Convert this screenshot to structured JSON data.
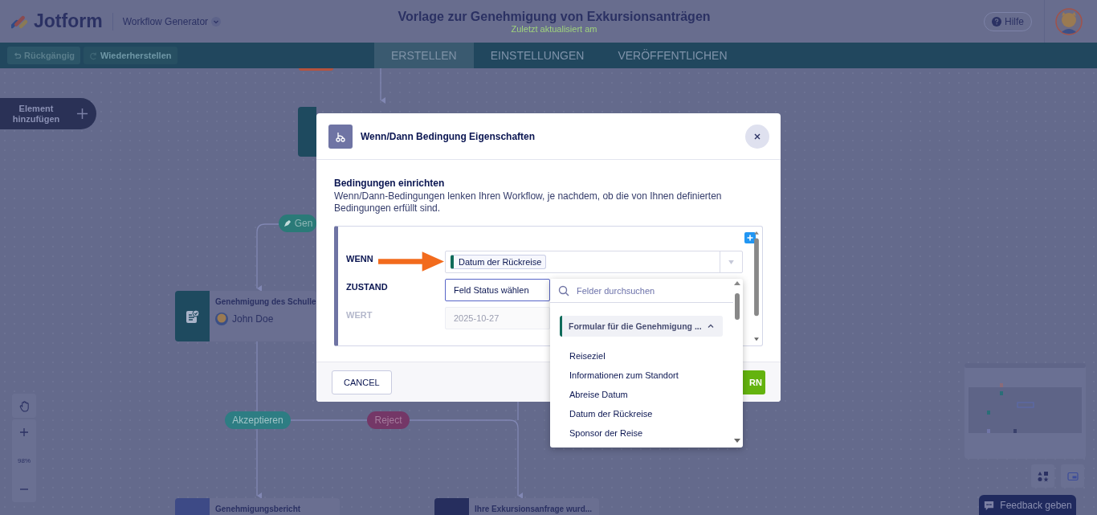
{
  "header": {
    "logo": "Jotform",
    "product": "Workflow Generator",
    "title": "Vorlage zur Genehmigung von Exkursionsanträgen",
    "subtitle": "Zuletzt aktualisiert am",
    "help": "Hilfe"
  },
  "toolbar": {
    "undo": "Rückgängig",
    "redo": "Wiederherstellen",
    "tabs": [
      {
        "label": "ERSTELLEN",
        "selected": true
      },
      {
        "label": "EINSTELLUNGEN",
        "selected": false
      },
      {
        "label": "VERÖFFENTLICHEN",
        "selected": false
      }
    ]
  },
  "canvas": {
    "add_element": "Element hinzufügen",
    "branch_labels": [
      {
        "text": "Gen",
        "kind": "start"
      },
      {
        "text": "Akzeptieren",
        "kind": "accept"
      },
      {
        "text": "Reject",
        "kind": "reject"
      }
    ],
    "nodes": [
      {
        "title": "Genehmigung des Schulle",
        "assignee": "John Doe",
        "kind": "approval"
      },
      {
        "title": "Genehmigungsbericht",
        "kind": "report"
      },
      {
        "title": "Ihre Exkursionsanfrage wurd...",
        "kind": "email"
      }
    ],
    "zoom": "98%",
    "feedback": "Feedback geben"
  },
  "dialog": {
    "title": "Wenn/Dann Bedingung Eigenschaften",
    "section_title": "Bedingungen einrichten",
    "description": "Wenn/Dann-Bedingungen lenken Ihren Workflow, je nachdem, ob die von Ihnen definierten Bedingungen erfüllt sind.",
    "rows": [
      {
        "label": "WENN",
        "kind": "chip",
        "value": "Datum der Rückreise",
        "disabled": false
      },
      {
        "label": "ZUSTAND",
        "kind": "select",
        "value": "Feld Status wählen",
        "disabled": false
      },
      {
        "label": "WERT",
        "kind": "input",
        "value": "2025-10-27",
        "disabled": true
      }
    ],
    "dropdown": {
      "placeholder": "Felder durchsuchen",
      "group": "Formular für die Genehmigung ...",
      "expanded": true,
      "items": [
        "Reiseziel",
        "Informationen zum Standort",
        "Abreise Datum",
        "Datum der Rückreise",
        "Sponsor der Reise"
      ]
    },
    "cancel": "CANCEL",
    "save": "RN"
  }
}
